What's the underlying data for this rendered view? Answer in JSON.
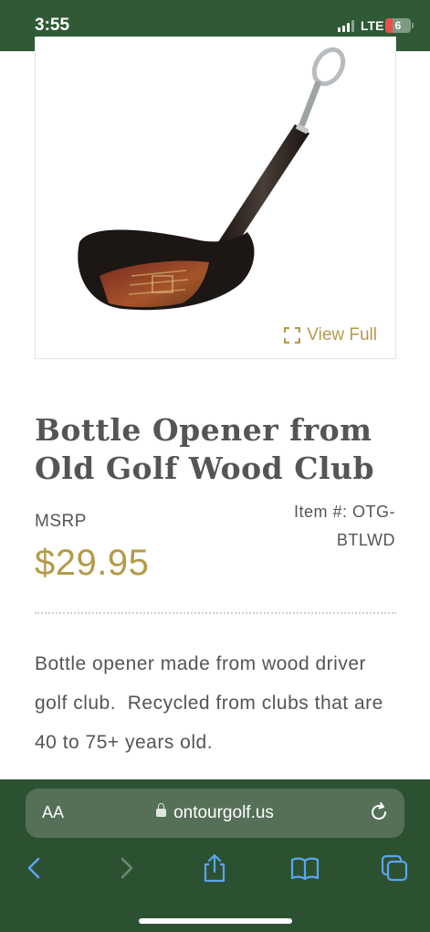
{
  "status_bar": {
    "time": "3:55",
    "network": "LTE",
    "battery_level": "6",
    "signal_icon": "cellular-signal-icon",
    "colors": {
      "background": "#2f5a35",
      "battery_low": "#e85050"
    }
  },
  "product": {
    "image_icon": "golf-club-bottle-opener-image",
    "view_full_label": "View Full",
    "title": "Bottle Opener from Old Golf Wood Club",
    "msrp_label": "MSRP",
    "item_number": "Item #: OTG-BTLWD",
    "price": "$29.95",
    "description": "Bottle opener made from wood driver golf club.  Recycled from clubs that are 40 to 75+ years old."
  },
  "browser": {
    "text_size_label": "AA",
    "url": "ontourgolf.us",
    "reload_icon": "reload-icon",
    "toolbar": [
      "back-icon",
      "forward-icon",
      "share-icon",
      "bookmarks-icon",
      "tabs-icon"
    ],
    "colors": {
      "chrome": "#2c5131",
      "accent": "#5aa5ef",
      "gold": "#b59a4a"
    }
  }
}
